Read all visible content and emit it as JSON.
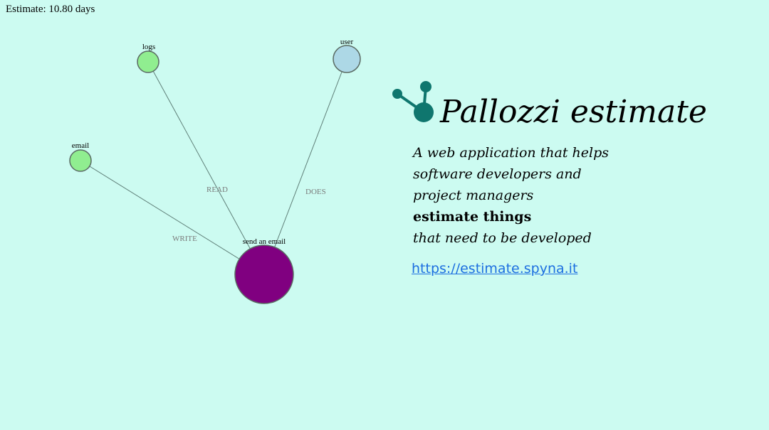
{
  "estimate": {
    "text": "Estimate: 10.80 days"
  },
  "graph": {
    "nodes": [
      {
        "id": "logs",
        "label": "logs",
        "color": "#90ee90"
      },
      {
        "id": "user",
        "label": "user",
        "color": "#add8e6"
      },
      {
        "id": "email",
        "label": "email",
        "color": "#90ee90"
      },
      {
        "id": "send_an_email",
        "label": "send an email",
        "color": "#800080"
      }
    ],
    "edges": [
      {
        "from": "send_an_email",
        "to": "logs",
        "label": "READ"
      },
      {
        "from": "send_an_email",
        "to": "user",
        "label": "DOES"
      },
      {
        "from": "send_an_email",
        "to": "email",
        "label": "WRITE"
      }
    ]
  },
  "brand": {
    "title": "Pallozzi estimate",
    "logo_icon": "molecule-icon",
    "logo_color": "#0f766e"
  },
  "tagline": {
    "line1": "A web application that helps",
    "line2": "software developers and",
    "line3": "project managers",
    "line4": "estimate things",
    "line5": "that need to be developed"
  },
  "link": {
    "text": "https://estimate.spyna.it",
    "color": "#1d6fe0"
  }
}
